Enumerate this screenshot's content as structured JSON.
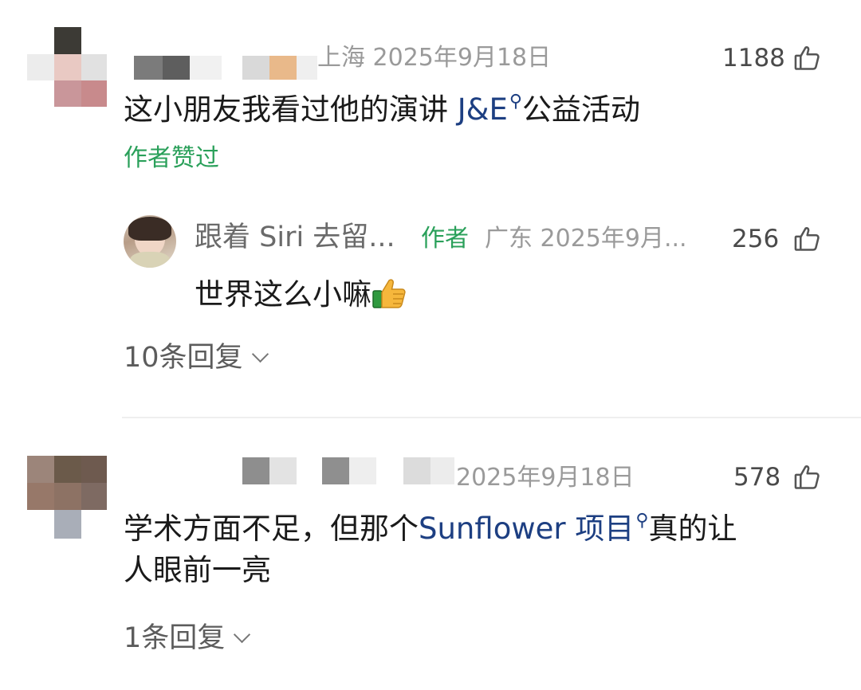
{
  "comments": [
    {
      "location_date": "上海 2025年9月18日",
      "likes": "1188",
      "text_before": "这小朋友我看过他的演讲 ",
      "link": "J&E",
      "text_after": "公益活动",
      "author_liked": "作者赞过",
      "reply": {
        "username": "跟着 Siri 去留...",
        "author_tag": "作者",
        "location_date": "广东 2025年9月...",
        "likes": "256",
        "text": "世界这么小嘛",
        "emoji": "👍"
      },
      "more_replies": "10条回复"
    },
    {
      "location_date": "2025年9月18日",
      "likes": "578",
      "text_before": "学术方面不足，但那个",
      "link": "Sunflower 项目",
      "text_after_line1": "真的让",
      "text_line2": "人眼前一亮",
      "more_replies": "1条回复"
    }
  ],
  "colors": {
    "link": "#1d3f82",
    "author_green": "#2aa05a",
    "meta_gray": "#9a9a9a"
  },
  "icons": {
    "like": "thumbs-up-outline-icon",
    "search_link": "magnifier-icon",
    "expand": "chevron-down-icon"
  }
}
